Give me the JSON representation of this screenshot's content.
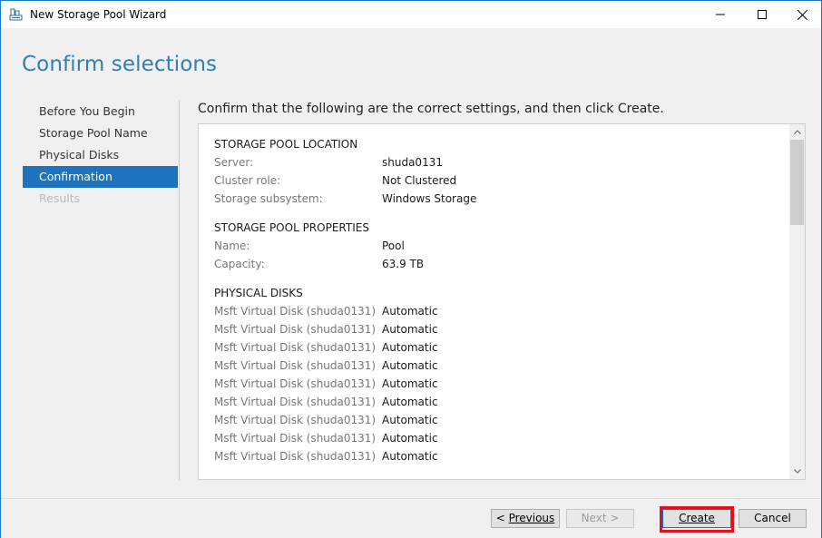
{
  "window": {
    "title": "New Storage Pool Wizard",
    "controls": {
      "minimize_icon": "minimize-icon",
      "maximize_icon": "maximize-icon",
      "close_icon": "close-icon"
    }
  },
  "page": {
    "title": "Confirm selections",
    "instruction": "Confirm that the following are the correct settings, and then click Create."
  },
  "nav": {
    "items": [
      {
        "label": "Before You Begin",
        "state": "normal"
      },
      {
        "label": "Storage Pool Name",
        "state": "normal"
      },
      {
        "label": "Physical Disks",
        "state": "normal"
      },
      {
        "label": "Confirmation",
        "state": "active"
      },
      {
        "label": "Results",
        "state": "disabled"
      }
    ]
  },
  "summary": {
    "location": {
      "heading": "STORAGE POOL LOCATION",
      "rows": [
        {
          "label": "Server:",
          "value": "shuda0131"
        },
        {
          "label": "Cluster role:",
          "value": "Not Clustered"
        },
        {
          "label": "Storage subsystem:",
          "value": "Windows Storage"
        }
      ]
    },
    "properties": {
      "heading": "STORAGE POOL PROPERTIES",
      "rows": [
        {
          "label": "Name:",
          "value": "Pool"
        },
        {
          "label": "Capacity:",
          "value": "63.9 TB"
        }
      ]
    },
    "disks": {
      "heading": "PHYSICAL DISKS",
      "rows": [
        {
          "label": "Msft Virtual Disk (shuda0131)",
          "value": "Automatic"
        },
        {
          "label": "Msft Virtual Disk (shuda0131)",
          "value": "Automatic"
        },
        {
          "label": "Msft Virtual Disk (shuda0131)",
          "value": "Automatic"
        },
        {
          "label": "Msft Virtual Disk (shuda0131)",
          "value": "Automatic"
        },
        {
          "label": "Msft Virtual Disk (shuda0131)",
          "value": "Automatic"
        },
        {
          "label": "Msft Virtual Disk (shuda0131)",
          "value": "Automatic"
        },
        {
          "label": "Msft Virtual Disk (shuda0131)",
          "value": "Automatic"
        },
        {
          "label": "Msft Virtual Disk (shuda0131)",
          "value": "Automatic"
        },
        {
          "label": "Msft Virtual Disk (shuda0131)",
          "value": "Automatic"
        }
      ]
    }
  },
  "footer": {
    "previous": {
      "label": "Previous",
      "prefix": "< "
    },
    "next": {
      "label": "Next",
      "suffix": " >"
    },
    "create": {
      "label": "Create"
    },
    "cancel": {
      "label": "Cancel"
    }
  },
  "colors": {
    "accent": "#1e73be",
    "title": "#2f7fb5",
    "highlight": "#e0101e"
  }
}
